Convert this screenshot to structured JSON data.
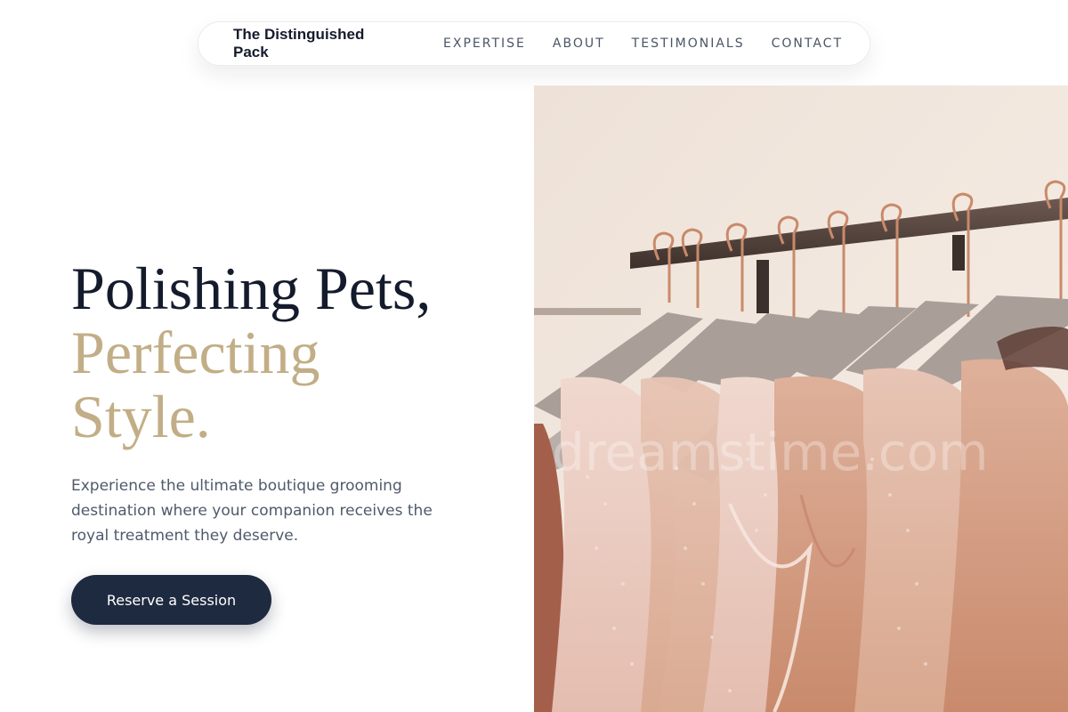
{
  "nav": {
    "brand": "The Distinguished Pack",
    "links": [
      "EXPERTISE",
      "ABOUT",
      "TESTIMONIALS",
      "CONTACT"
    ]
  },
  "hero": {
    "headline_line1": "Polishing Pets,",
    "headline_line2": "Perfecting",
    "headline_line3": "Style.",
    "description": "Experience the ultimate boutique grooming destination where your companion receives the royal treatment they deserve.",
    "cta_label": "Reserve a Session"
  },
  "image": {
    "subject": "garments-on-hangers-photo",
    "watermark": "dreamstime.com"
  },
  "colors": {
    "navy": "#1e2a3f",
    "gold": "#c2ae86",
    "text_dark": "#141b2c",
    "text_muted": "#4f5a6b"
  }
}
